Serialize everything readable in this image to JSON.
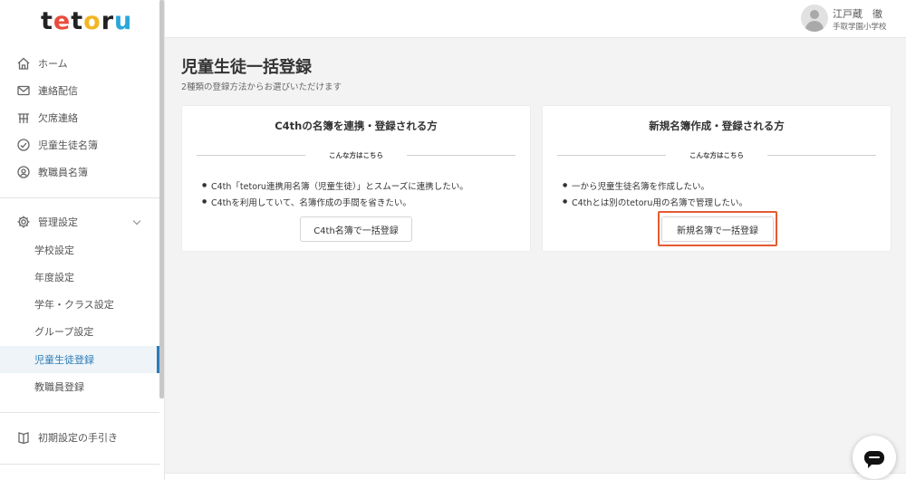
{
  "app": {
    "logo": {
      "t1": "te",
      "t2": "to",
      "t3": "ru"
    }
  },
  "sidebar": {
    "items": [
      {
        "label": "ホーム",
        "icon": "home-icon"
      },
      {
        "label": "連絡配信",
        "icon": "mail-icon"
      },
      {
        "label": "欠席連絡",
        "icon": "absence-icon"
      },
      {
        "label": "児童生徒名簿",
        "icon": "student-roster-icon"
      },
      {
        "label": "教職員名簿",
        "icon": "staff-roster-icon"
      }
    ],
    "admin": {
      "label": "管理設定",
      "icon": "gear-icon"
    },
    "sub_items": [
      {
        "label": "学校設定"
      },
      {
        "label": "年度設定"
      },
      {
        "label": "学年・クラス設定"
      },
      {
        "label": "グループ設定"
      },
      {
        "label": "児童生徒登録",
        "active": true
      },
      {
        "label": "教職員登録"
      }
    ],
    "guide": {
      "label": "初期設定の手引き",
      "icon": "book-icon"
    }
  },
  "header": {
    "user_name": "江戸蔵　徹",
    "school_name": "手取学園小学校"
  },
  "main": {
    "title": "児童生徒一括登録",
    "subtitle": "2種類の登録方法からお選びいただけます",
    "cards": [
      {
        "title": "C4thの名簿を連携・登録される方",
        "separator": "こんな方はこちら",
        "bullets": [
          "C4th「tetoru連携用名簿（児童生徒）」とスムーズに連携したい。",
          "C4thを利用していて、名簿作成の手間を省きたい。"
        ],
        "button": "C4th名簿で一括登録"
      },
      {
        "title": "新規名簿作成・登録される方",
        "separator": "こんな方はこちら",
        "bullets": [
          "一から児童生徒名簿を作成したい。",
          "C4thとは別のtetoru用の名簿で管理したい。"
        ],
        "button": "新規名簿で一括登録"
      }
    ]
  },
  "colors": {
    "accent": "#2e7cb8",
    "highlight": "#e45a33"
  }
}
